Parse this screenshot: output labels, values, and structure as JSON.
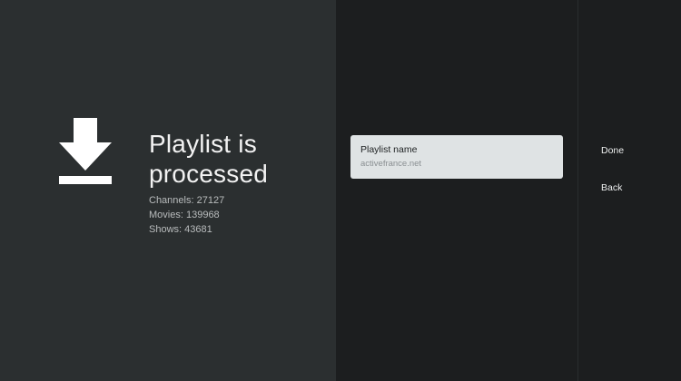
{
  "status": {
    "icon": "download-icon",
    "title": "Playlist is\nprocessed",
    "stats": [
      {
        "label": "Channels",
        "value": "27127"
      },
      {
        "label": "Movies",
        "value": "139968"
      },
      {
        "label": "Shows",
        "value": "43681"
      }
    ]
  },
  "playlist_card": {
    "label": "Playlist name",
    "value": "activefrance.net"
  },
  "actions": {
    "done_label": "Done",
    "back_label": "Back"
  },
  "colors": {
    "left_panel": "#2b2f30",
    "middle_panel": "#1c1e1f",
    "card": "#dfe3e4",
    "text_primary": "#f2f2f2"
  }
}
